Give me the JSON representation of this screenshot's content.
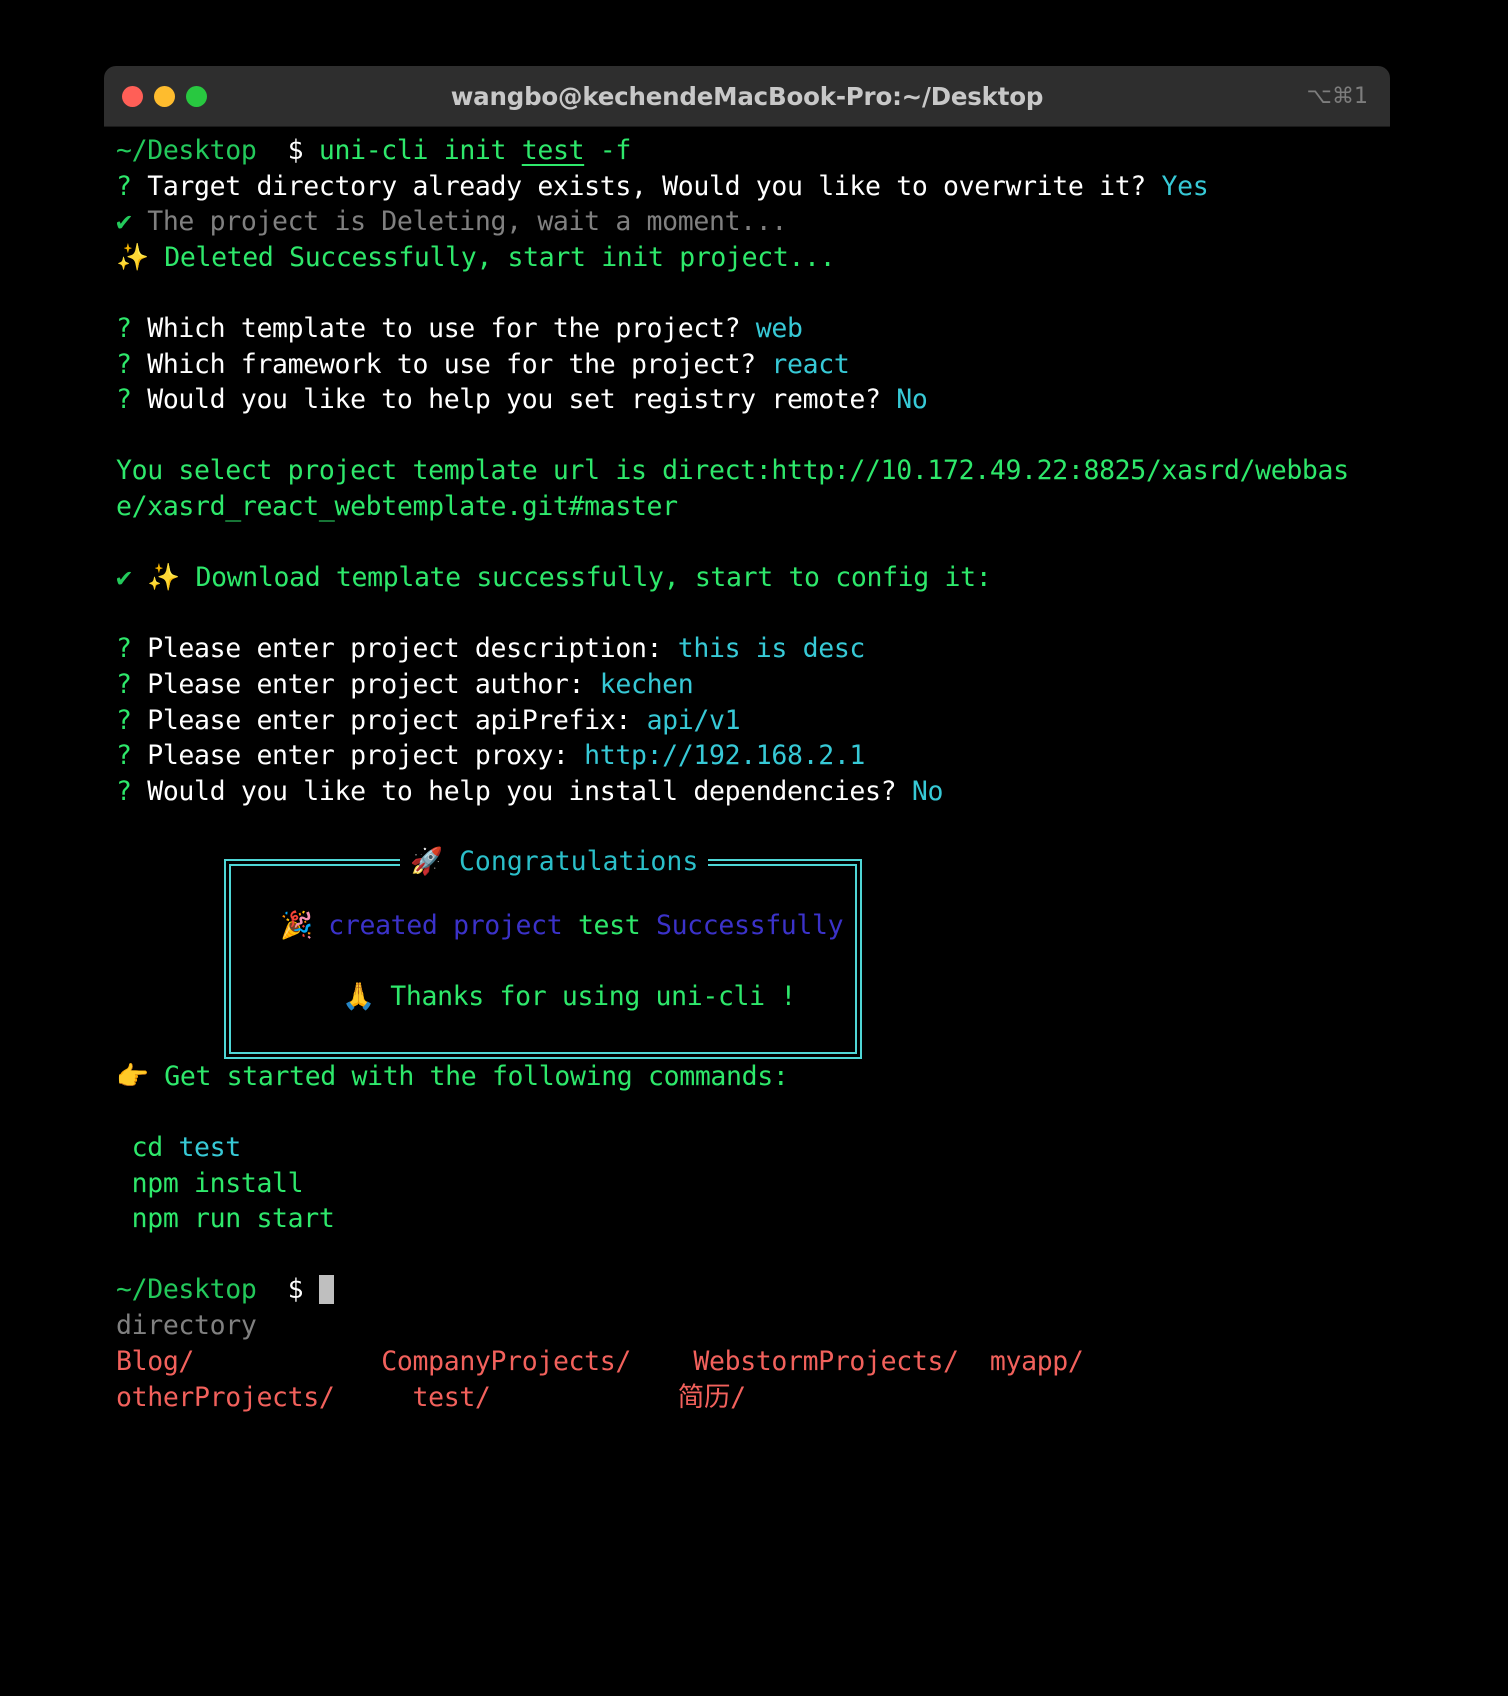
{
  "window": {
    "title": "wangbo@kechendeMacBook-Pro:~/Desktop",
    "shortcut": "⌥⌘1",
    "buttons": {
      "close": "close-button",
      "minimize": "minimize-button",
      "maximize": "maximize-button"
    }
  },
  "colors": {
    "green": "#2ee86b",
    "cyan": "#37c9d6",
    "blue": "#3b32c9",
    "red": "#f2615c",
    "gray": "#808080",
    "box_border": "#4fd6d6",
    "titlebar": "#2e2e2e",
    "background": "#000000"
  },
  "terminal": {
    "prompt1": {
      "path": "~/Desktop",
      "symbol": "$",
      "command": "uni-cli init ",
      "arg": "test",
      "flag": " -f"
    },
    "q_overwrite": {
      "mark": "?",
      "text": "Target directory already exists, Would you like to overwrite it?",
      "answer": "Yes"
    },
    "deleting": {
      "mark": "✔",
      "text": "The project is Deleting, wait a moment..."
    },
    "deleted": {
      "emoji": "✨",
      "text": "Deleted Successfully, start init project..."
    },
    "q_template": {
      "mark": "?",
      "text": "Which template to use for the project?",
      "answer": "web"
    },
    "q_framework": {
      "mark": "?",
      "text": "Which framework to use for the project?",
      "answer": "react"
    },
    "q_registry": {
      "mark": "?",
      "text": "Would you like to help you set registry remote?",
      "answer": "No"
    },
    "url_line1": "You select project template url is direct:http://10.172.49.22:8825/xasrd/webbas",
    "url_line2": "e/xasrd_react_webtemplate.git#master",
    "download": {
      "mark": "✔",
      "emoji": "✨",
      "text": "Download template successfully, start to config it:"
    },
    "q_description": {
      "mark": "?",
      "text": "Please enter project description:",
      "answer": "this is desc"
    },
    "q_author": {
      "mark": "?",
      "text": "Please enter project author:",
      "answer": "kechen"
    },
    "q_apiprefix": {
      "mark": "?",
      "text": "Please enter project apiPrefix:",
      "answer": "api/v1"
    },
    "q_proxy": {
      "mark": "?",
      "text": "Please enter project proxy:",
      "answer": "http://192.168.2.1"
    },
    "q_dependencies": {
      "mark": "?",
      "text": "Would you like to help you install dependencies?",
      "answer": "No"
    },
    "congrats_box": {
      "title_emoji": "🚀",
      "title": "Congratulations",
      "line1_emoji": "🎉",
      "line1_a": "created project ",
      "line1_b": "test",
      "line1_c": " Successfully",
      "line2_emoji": "🙏",
      "line2": "Thanks for using uni-cli !"
    },
    "get_started": {
      "emoji": "👉",
      "text": "Get started with the following commands:"
    },
    "commands": [
      {
        "cmd": "cd",
        "arg": "test"
      },
      {
        "cmd": "npm install",
        "arg": ""
      },
      {
        "cmd": "npm run start",
        "arg": ""
      }
    ],
    "prompt2": {
      "path": "~/Desktop",
      "symbol": "$"
    },
    "completion_hint": "directory",
    "dir_row1": [
      "Blog/",
      "CompanyProjects/",
      "WebstormProjects/",
      "myapp/"
    ],
    "dir_row2": [
      "otherProjects/",
      "test/",
      "简历/"
    ]
  }
}
